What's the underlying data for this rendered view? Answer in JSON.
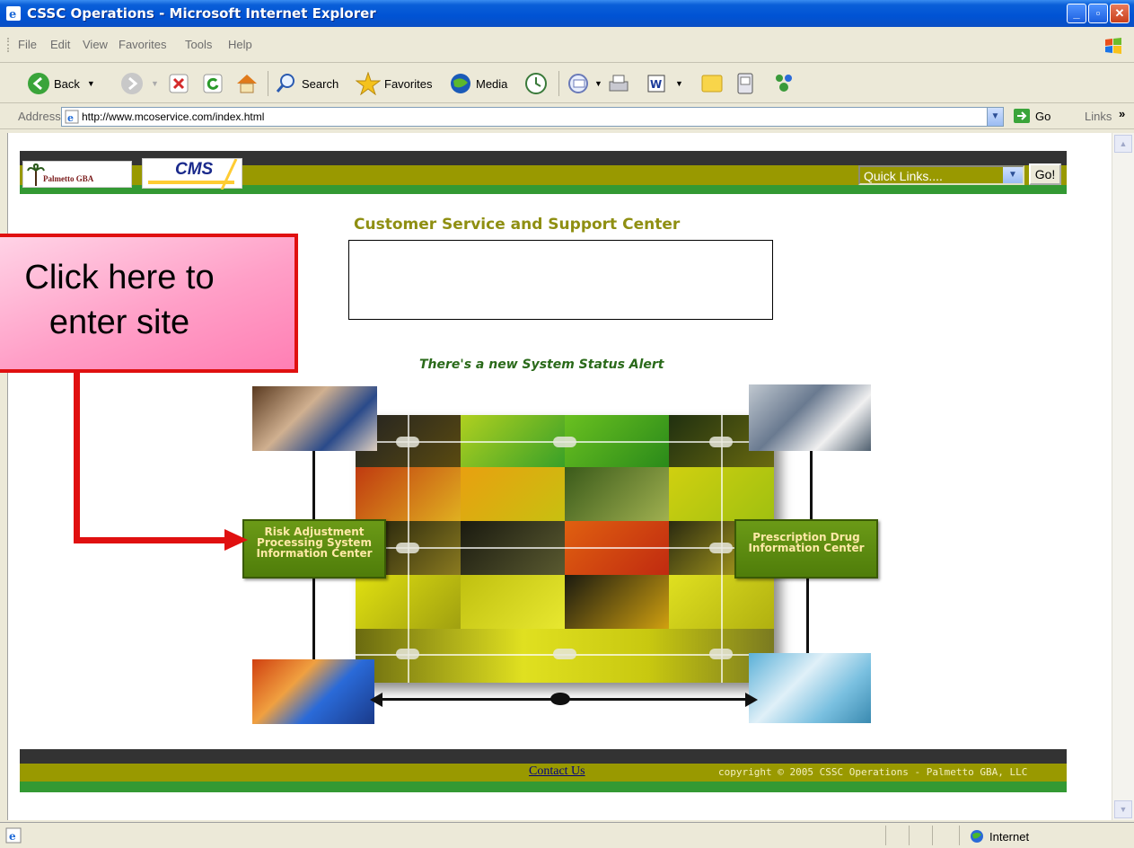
{
  "window": {
    "title": "CSSC Operations - Microsoft Internet Explorer"
  },
  "menu": {
    "items": [
      "File",
      "Edit",
      "View",
      "Favorites",
      "Tools",
      "Help"
    ]
  },
  "toolbar": {
    "back_label": "Back",
    "search_label": "Search",
    "favorites_label": "Favorites",
    "media_label": "Media"
  },
  "address_bar": {
    "label": "Address",
    "url": "http://www.mcoservice.com/index.html",
    "go_label": "Go",
    "links_label": "Links"
  },
  "site": {
    "palmetto_logo_text": "Palmetto GBA",
    "cms_logo_text": "CMS",
    "quick_links_value": "Quick Links....",
    "go_button": "Go!",
    "heading": "Customer Service and Support Center",
    "status_alert": "There's a new System Status Alert",
    "left_button": "Risk Adjustment Processing System Information Center",
    "right_button": "Prescription Drug Information Center",
    "footer_link": "Contact Us",
    "copyright": "copyright © 2005 CSSC Operations - Palmetto GBA, LLC"
  },
  "callout": {
    "text": "Click here to enter site",
    "color": "#e01010"
  },
  "statusbar": {
    "zone": "Internet"
  },
  "colors": {
    "olive": "#999900",
    "dark_band": "#333333",
    "green_band": "#339933",
    "heading": "#8f8f12",
    "alert": "#2a6a1a"
  }
}
